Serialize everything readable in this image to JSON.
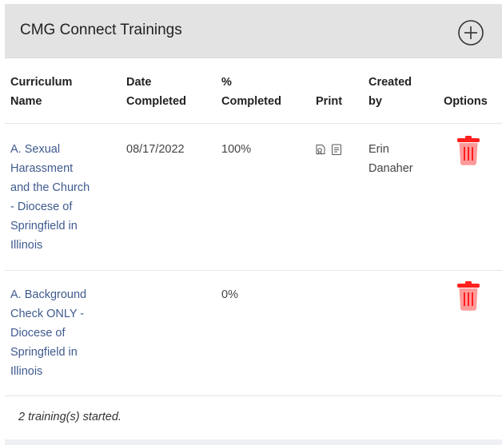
{
  "panel": {
    "title": "CMG Connect Trainings",
    "add_icon": "plus-circle-icon"
  },
  "columns": {
    "curriculum_line1": "Curriculum",
    "curriculum_line2": "Name",
    "date_line1": "Date",
    "date_line2": "Completed",
    "percent_line1": "%",
    "percent_line2": "Completed",
    "print": "Print",
    "created_line1": "Created",
    "created_line2": "by",
    "options": "Options"
  },
  "rows": [
    {
      "name_lines": [
        "A. Sexual",
        "Harassment",
        "and the Church",
        "- Diocese of",
        "Springfield in",
        "Illinois"
      ],
      "date_completed": "08/17/2022",
      "percent_completed": "100%",
      "print_icons": [
        "certificate-icon",
        "document-icon"
      ],
      "created_by_lines": [
        "Erin",
        "Danaher"
      ],
      "delete_icon": "trash-icon",
      "percent_value": 1.0
    },
    {
      "name_lines": [
        "A. Background",
        "Check ONLY -",
        "Diocese of",
        "Springfield in",
        "Illinois"
      ],
      "date_completed": "",
      "percent_completed": "0%",
      "print_icons": [],
      "created_by_lines": [],
      "delete_icon": "trash-icon",
      "percent_value": 0.0
    }
  ],
  "footer": {
    "summary": "2 training(s) started."
  },
  "colors": {
    "header_bg": "#e3e3e3",
    "link": "#3f5a8e",
    "trash_red": "#ff1f1f",
    "trash_light": "#ff9a9a"
  }
}
